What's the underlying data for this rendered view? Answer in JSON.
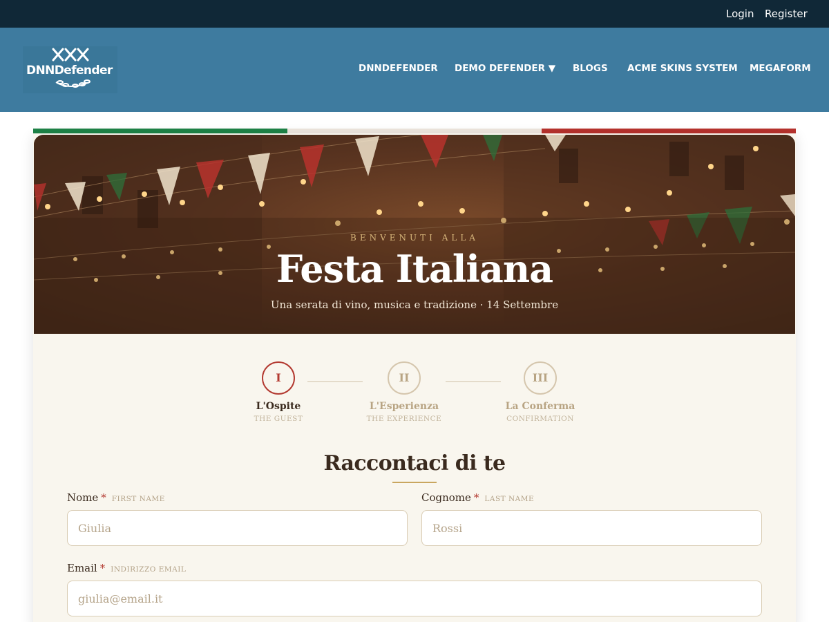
{
  "topbar": {
    "login": "Login",
    "register": "Register"
  },
  "header": {
    "logo_text": "DNNDefender",
    "nav": [
      {
        "label": "DNNDEFENDER"
      },
      {
        "label": "DEMO DEFENDER ▼"
      },
      {
        "label": "BLOGS"
      },
      {
        "label": "ACME SKINS SYSTEM"
      },
      {
        "label": "MEGAFORM"
      }
    ]
  },
  "colors": {
    "topbar": "#102837",
    "header": "#3e7b9f",
    "italy_green": "#1e8347",
    "italy_white": "#eee7df",
    "italy_red": "#b7322d",
    "accent_red": "#b33a31",
    "gold": "#c9a65f"
  },
  "hero": {
    "eyebrow": "BENVENUTI ALLA",
    "title": "Festa Italiana",
    "subtitle": "Una serata di vino, musica e tradizione · 14 Settembre"
  },
  "stepper": {
    "steps": [
      {
        "numeral": "I",
        "label": "L'Ospite",
        "sub": "THE GUEST",
        "active": true
      },
      {
        "numeral": "II",
        "label": "L'Esperienza",
        "sub": "THE EXPERIENCE",
        "active": false
      },
      {
        "numeral": "III",
        "label": "La Conferma",
        "sub": "CONFIRMATION",
        "active": false
      }
    ]
  },
  "form": {
    "section_title": "Raccontaci di te",
    "first_name": {
      "label": "Nome",
      "required": "*",
      "hint": "FIRST NAME",
      "placeholder": "Giulia"
    },
    "last_name": {
      "label": "Cognome",
      "required": "*",
      "hint": "LAST NAME",
      "placeholder": "Rossi"
    },
    "email": {
      "label": "Email",
      "required": "*",
      "hint": "INDIRIZZO EMAIL",
      "placeholder": "giulia@email.it"
    }
  }
}
